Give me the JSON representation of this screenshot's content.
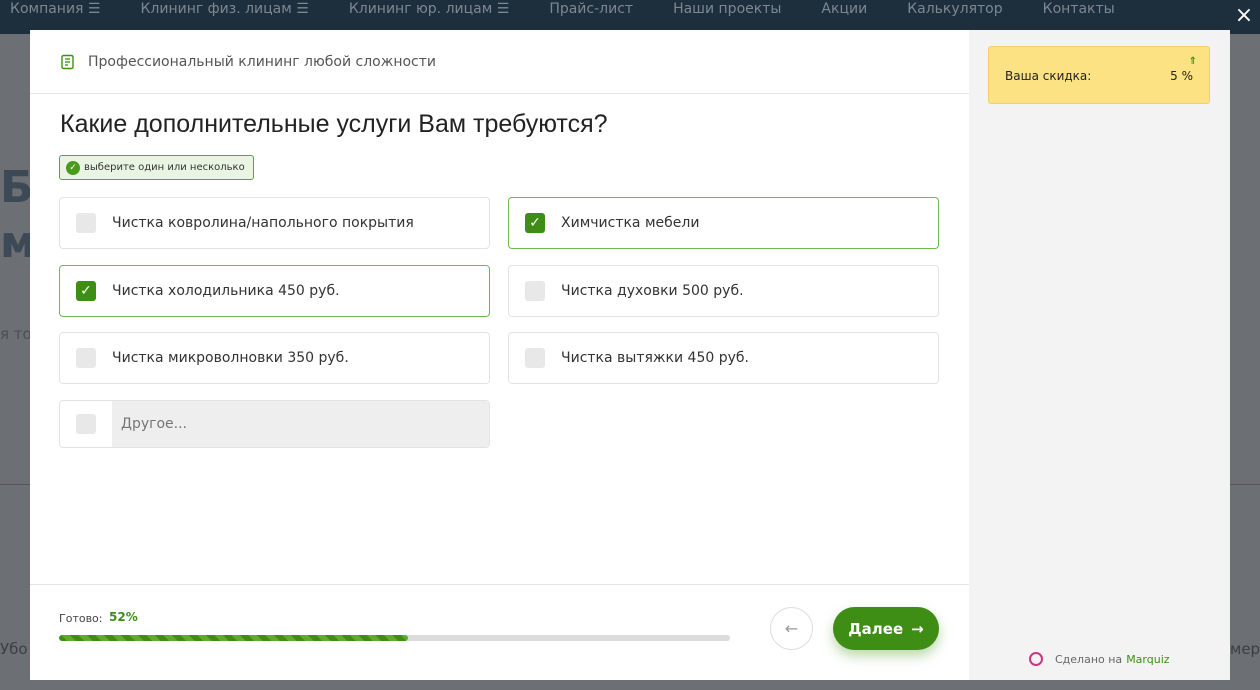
{
  "background": {
    "nav": [
      "Компания ☰",
      "Клининг физ. лицам ☰",
      "Клининг юр. лицам ☰",
      "Прайс-лист",
      "Наши проекты",
      "Акции",
      "Калькулятор",
      "Контакты"
    ],
    "edge_heading": "Бе ме",
    "edge_text": "я то",
    "bottom_left": "Убо",
    "bottom_right": "мер"
  },
  "close_icon": "×",
  "header": {
    "title": "Профессиональный клининг любой сложности"
  },
  "question": "Какие дополнительные услуги Вам требуются?",
  "hint": "выберите один или несколько",
  "options": [
    {
      "label": "Чистка ковролина/напольного покрытия",
      "selected": false
    },
    {
      "label": "Химчистка мебели",
      "selected": true
    },
    {
      "label": "Чистка холодильника 450 руб.",
      "selected": true
    },
    {
      "label": "Чистка духовки 500 руб.",
      "selected": false
    },
    {
      "label": "Чистка микроволновки 350 руб.",
      "selected": false
    },
    {
      "label": "Чистка вытяжки 450 руб.",
      "selected": false
    }
  ],
  "other": {
    "placeholder": "Другое...",
    "selected": false
  },
  "progress": {
    "label": "Готово:",
    "value_text": "52%",
    "percent": 52
  },
  "buttons": {
    "back_icon": "←",
    "next_label": "Далее",
    "next_icon": "→"
  },
  "discount": {
    "label": "Ваша скидка:",
    "value": "5 %",
    "arrow_icon": "⇑"
  },
  "made_by": {
    "text": "Сделано на",
    "brand": "Marquiz"
  },
  "colors": {
    "accent": "#3e8e16",
    "discount_bg": "#fde283",
    "sidebar_bg": "#f3f3f3"
  }
}
